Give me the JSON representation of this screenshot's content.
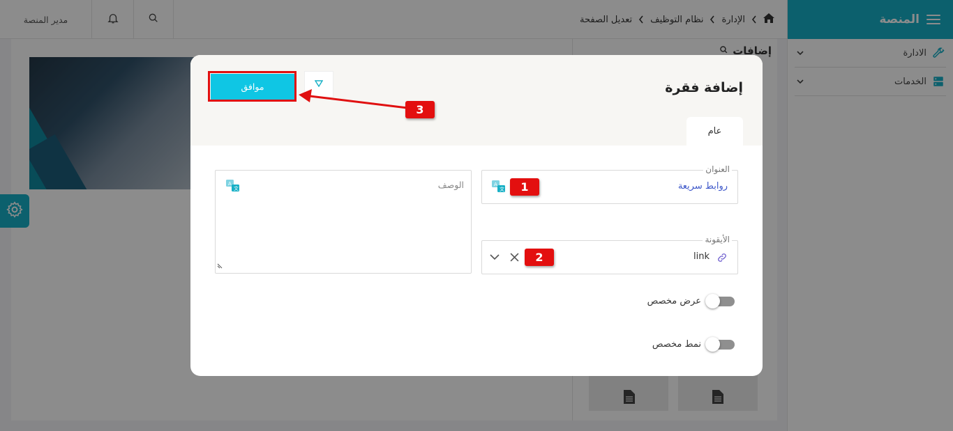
{
  "app": {
    "title": "المنصة",
    "accent": "#17b0c6",
    "sidebar": {
      "items": [
        {
          "label": "الادارة",
          "icon": "wrench-icon"
        },
        {
          "label": "الخدمات",
          "icon": "server-icon"
        }
      ]
    },
    "breadcrumb": [
      "الإدارة",
      "نظام التوظيف",
      "تعديل الصفحة"
    ],
    "user_label": "مدير المنصة",
    "right_panel_title": "إضافات"
  },
  "modal": {
    "title": "إضافة فقرة",
    "ok_label": "موافق",
    "tab_general": "عام",
    "title_field": {
      "legend": "العنوان",
      "value": "روابط سريعة"
    },
    "description_field": {
      "placeholder": "الوصف"
    },
    "icon_field": {
      "legend": "الأيقونة",
      "value": "link"
    },
    "toggles": [
      {
        "label": "عرض مخصص",
        "on": false
      },
      {
        "label": "نمط مخصص",
        "on": false
      }
    ]
  },
  "annotations": {
    "badge_1": "1",
    "badge_2": "2",
    "badge_3": "3",
    "highlight_color": "#e01010"
  }
}
